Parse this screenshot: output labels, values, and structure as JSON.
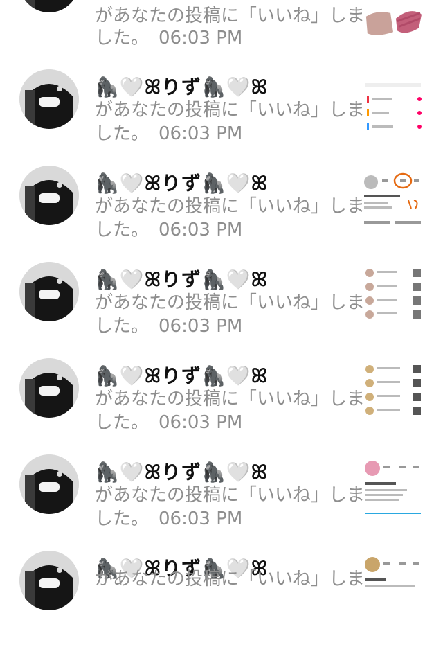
{
  "notifications": [
    {
      "name": "",
      "message_line1": "があなたの投稿に「いいね」しま",
      "message_line2": "した。",
      "time": "06:03 PM",
      "thumb": "makeup-swatch"
    },
    {
      "name": "🦍🤍ꕤりず🦍🤍ꕤ",
      "message_line1": "があなたの投稿に「いいね」しま",
      "message_line2": "した。",
      "time": "06:03 PM",
      "thumb": "settings-screenshot"
    },
    {
      "name": "🦍🤍ꕤりず🦍🤍ꕤ",
      "message_line1": "があなたの投稿に「いいね」しま",
      "message_line2": "した。",
      "time": "06:03 PM",
      "thumb": "profile-screenshot"
    },
    {
      "name": "🦍🤍ꕤりず🦍🤍ꕤ",
      "message_line1": "があなたの投稿に「いいね」しま",
      "message_line2": "した。",
      "time": "06:03 PM",
      "thumb": "feed-screenshot"
    },
    {
      "name": "🦍🤍ꕤりず🦍🤍ꕤ",
      "message_line1": "があなたの投稿に「いいね」しま",
      "message_line2": "した。",
      "time": "06:03 PM",
      "thumb": "feed-screenshot-2"
    },
    {
      "name": "🦍🤍ꕤりず🦍🤍ꕤ",
      "message_line1": "があなたの投稿に「いいね」しま",
      "message_line2": "した。",
      "time": "06:03 PM",
      "thumb": "profile-screenshot-2"
    },
    {
      "name": "🦍🤍ꕤりず🦍🤍ꕤ",
      "message_line1": "があなたの投稿に「いいね」しま",
      "message_line2": "",
      "time": "",
      "thumb": "profile-screenshot-3"
    }
  ]
}
